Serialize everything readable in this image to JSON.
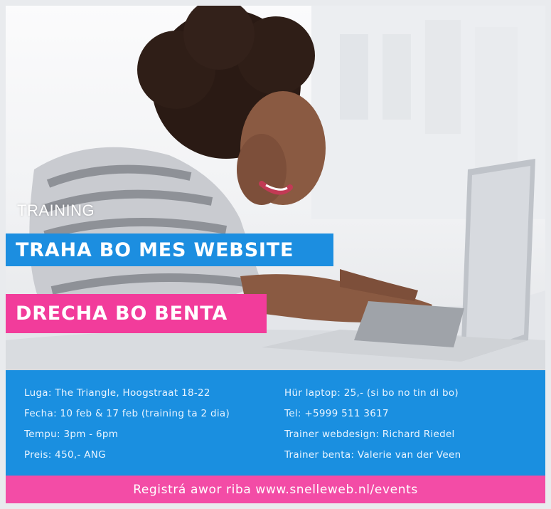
{
  "colors": {
    "blue_banner": "#1c8ee0",
    "pink_banner": "#f23c9b",
    "info_background": "#1a8fe0",
    "footer_background": "#f34ca6"
  },
  "hero": {
    "eyebrow": "TRAINING",
    "banner_blue": "TRAHA BO MES WEBSITE",
    "banner_pink": "DRECHA BO BENTA"
  },
  "info": {
    "left": [
      "Luga: The Triangle, Hoogstraat 18-22",
      "Fecha: 10 feb & 17 feb (training ta 2 dia)",
      "Tempu: 3pm - 6pm",
      "Preis: 450,- ANG"
    ],
    "right": [
      "Hür laptop: 25,- (si bo no tin di bo)",
      "Tel: +5999 511 3617",
      "Trainer webdesign: Richard Riedel",
      "Trainer benta: Valerie van der Veen"
    ]
  },
  "footer": {
    "text": "Registrá awor riba www.snelleweb.nl/events"
  }
}
